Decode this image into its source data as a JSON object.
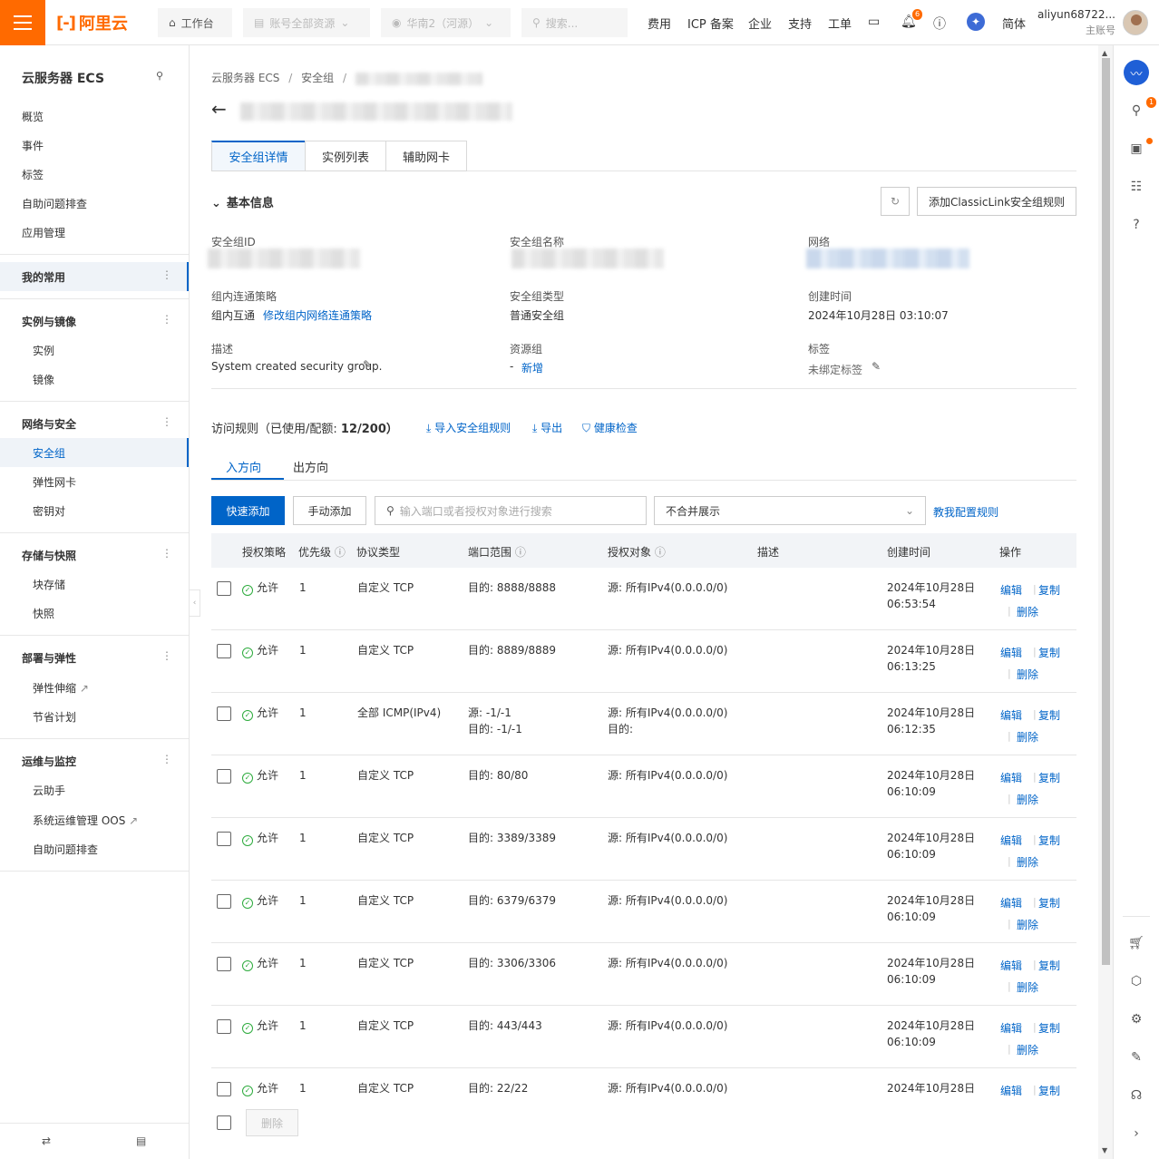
{
  "topbar": {
    "brand": "阿里云",
    "workbench": "工作台",
    "account_resources": "账号全部资源",
    "region": "华南2（河源）",
    "search_placeholder": "搜索...",
    "nav": [
      "费用",
      "ICP 备案",
      "企业",
      "支持",
      "工单"
    ],
    "notification_count": "6",
    "language": "简体",
    "username": "aliyun68722...",
    "account_type": "主账号"
  },
  "sidebar": {
    "title": "云服务器 ECS",
    "top_items": [
      "概览",
      "事件",
      "标签",
      "自助问题排查",
      "应用管理"
    ],
    "favorites": "我的常用",
    "groups": [
      {
        "label": "实例与镜像",
        "items": [
          "实例",
          "镜像"
        ]
      },
      {
        "label": "网络与安全",
        "items": [
          "安全组",
          "弹性网卡",
          "密钥对"
        ]
      },
      {
        "label": "存储与快照",
        "items": [
          "块存储",
          "快照"
        ]
      },
      {
        "label": "部署与弹性",
        "items": [
          "弹性伸缩",
          "节省计划"
        ]
      },
      {
        "label": "运维与监控",
        "items": [
          "云助手",
          "系统运维管理 OOS",
          "自助问题排查"
        ]
      }
    ],
    "active_item": "安全组"
  },
  "breadcrumb": {
    "level1": "云服务器 ECS",
    "level2": "安全组"
  },
  "tabs": [
    "安全组详情",
    "实例列表",
    "辅助网卡"
  ],
  "basic_info": {
    "section_title": "基本信息",
    "add_rule_button": "添加ClassicLink安全组规则",
    "fields": {
      "sg_id_label": "安全组ID",
      "sg_name_label": "安全组名称",
      "network_label": "网络",
      "intra_policy_label": "组内连通策略",
      "intra_policy_value": "组内互通",
      "intra_policy_link": "修改组内网络连通策略",
      "sg_type_label": "安全组类型",
      "sg_type_value": "普通安全组",
      "created_label": "创建时间",
      "created_value": "2024年10月28日 03:10:07",
      "desc_label": "描述",
      "desc_value": "System created security group.",
      "rg_label": "资源组",
      "rg_value": "-",
      "rg_link": "新增",
      "tag_label": "标签",
      "tag_value": "未绑定标签"
    }
  },
  "rules": {
    "header": "访问规则（已使用/配额:",
    "quota": "12/200）",
    "import": "导入安全组规则",
    "export": "导出",
    "health": "健康检查",
    "direction_tabs": [
      "入方向",
      "出方向"
    ],
    "quick_add": "快速添加",
    "manual_add": "手动添加",
    "search_placeholder": "输入端口或者授权对象进行搜索",
    "merge_select": "不合并展示",
    "teach_link": "教我配置规则",
    "columns": [
      "授权策略",
      "优先级",
      "协议类型",
      "端口范围",
      "授权对象",
      "描述",
      "创建时间",
      "操作"
    ],
    "actions": {
      "edit": "编辑",
      "copy": "复制",
      "delete": "删除"
    },
    "bulk_delete": "删除",
    "rows": [
      {
        "policy": "允许",
        "priority": "1",
        "protocol": "自定义 TCP",
        "port": "目的: 8888/8888",
        "port2": "",
        "object": "源: 所有IPv4(0.0.0.0/0)",
        "object2": "",
        "date": "2024年10月28日",
        "time": "06:53:54"
      },
      {
        "policy": "允许",
        "priority": "1",
        "protocol": "自定义 TCP",
        "port": "目的: 8889/8889",
        "port2": "",
        "object": "源: 所有IPv4(0.0.0.0/0)",
        "object2": "",
        "date": "2024年10月28日",
        "time": "06:13:25"
      },
      {
        "policy": "允许",
        "priority": "1",
        "protocol": "全部 ICMP(IPv4)",
        "port": "源: -1/-1",
        "port2": "目的: -1/-1",
        "object": "源: 所有IPv4(0.0.0.0/0)",
        "object2": "目的:",
        "date": "2024年10月28日",
        "time": "06:12:35"
      },
      {
        "policy": "允许",
        "priority": "1",
        "protocol": "自定义 TCP",
        "port": "目的: 80/80",
        "port2": "",
        "object": "源: 所有IPv4(0.0.0.0/0)",
        "object2": "",
        "date": "2024年10月28日",
        "time": "06:10:09"
      },
      {
        "policy": "允许",
        "priority": "1",
        "protocol": "自定义 TCP",
        "port": "目的: 3389/3389",
        "port2": "",
        "object": "源: 所有IPv4(0.0.0.0/0)",
        "object2": "",
        "date": "2024年10月28日",
        "time": "06:10:09"
      },
      {
        "policy": "允许",
        "priority": "1",
        "protocol": "自定义 TCP",
        "port": "目的: 6379/6379",
        "port2": "",
        "object": "源: 所有IPv4(0.0.0.0/0)",
        "object2": "",
        "date": "2024年10月28日",
        "time": "06:10:09"
      },
      {
        "policy": "允许",
        "priority": "1",
        "protocol": "自定义 TCP",
        "port": "目的: 3306/3306",
        "port2": "",
        "object": "源: 所有IPv4(0.0.0.0/0)",
        "object2": "",
        "date": "2024年10月28日",
        "time": "06:10:09"
      },
      {
        "policy": "允许",
        "priority": "1",
        "protocol": "自定义 TCP",
        "port": "目的: 443/443",
        "port2": "",
        "object": "源: 所有IPv4(0.0.0.0/0)",
        "object2": "",
        "date": "2024年10月28日",
        "time": "06:10:09"
      },
      {
        "policy": "允许",
        "priority": "1",
        "protocol": "自定义 TCP",
        "port": "目的: 22/22",
        "port2": "",
        "object": "源: 所有IPv4(0.0.0.0/0)",
        "object2": "",
        "date": "2024年10月28日",
        "time": ""
      }
    ]
  },
  "colors": {
    "brand": "#ff6a00",
    "link": "#0064c8",
    "ok": "#2dab3d"
  },
  "rightbar_badge": "1"
}
